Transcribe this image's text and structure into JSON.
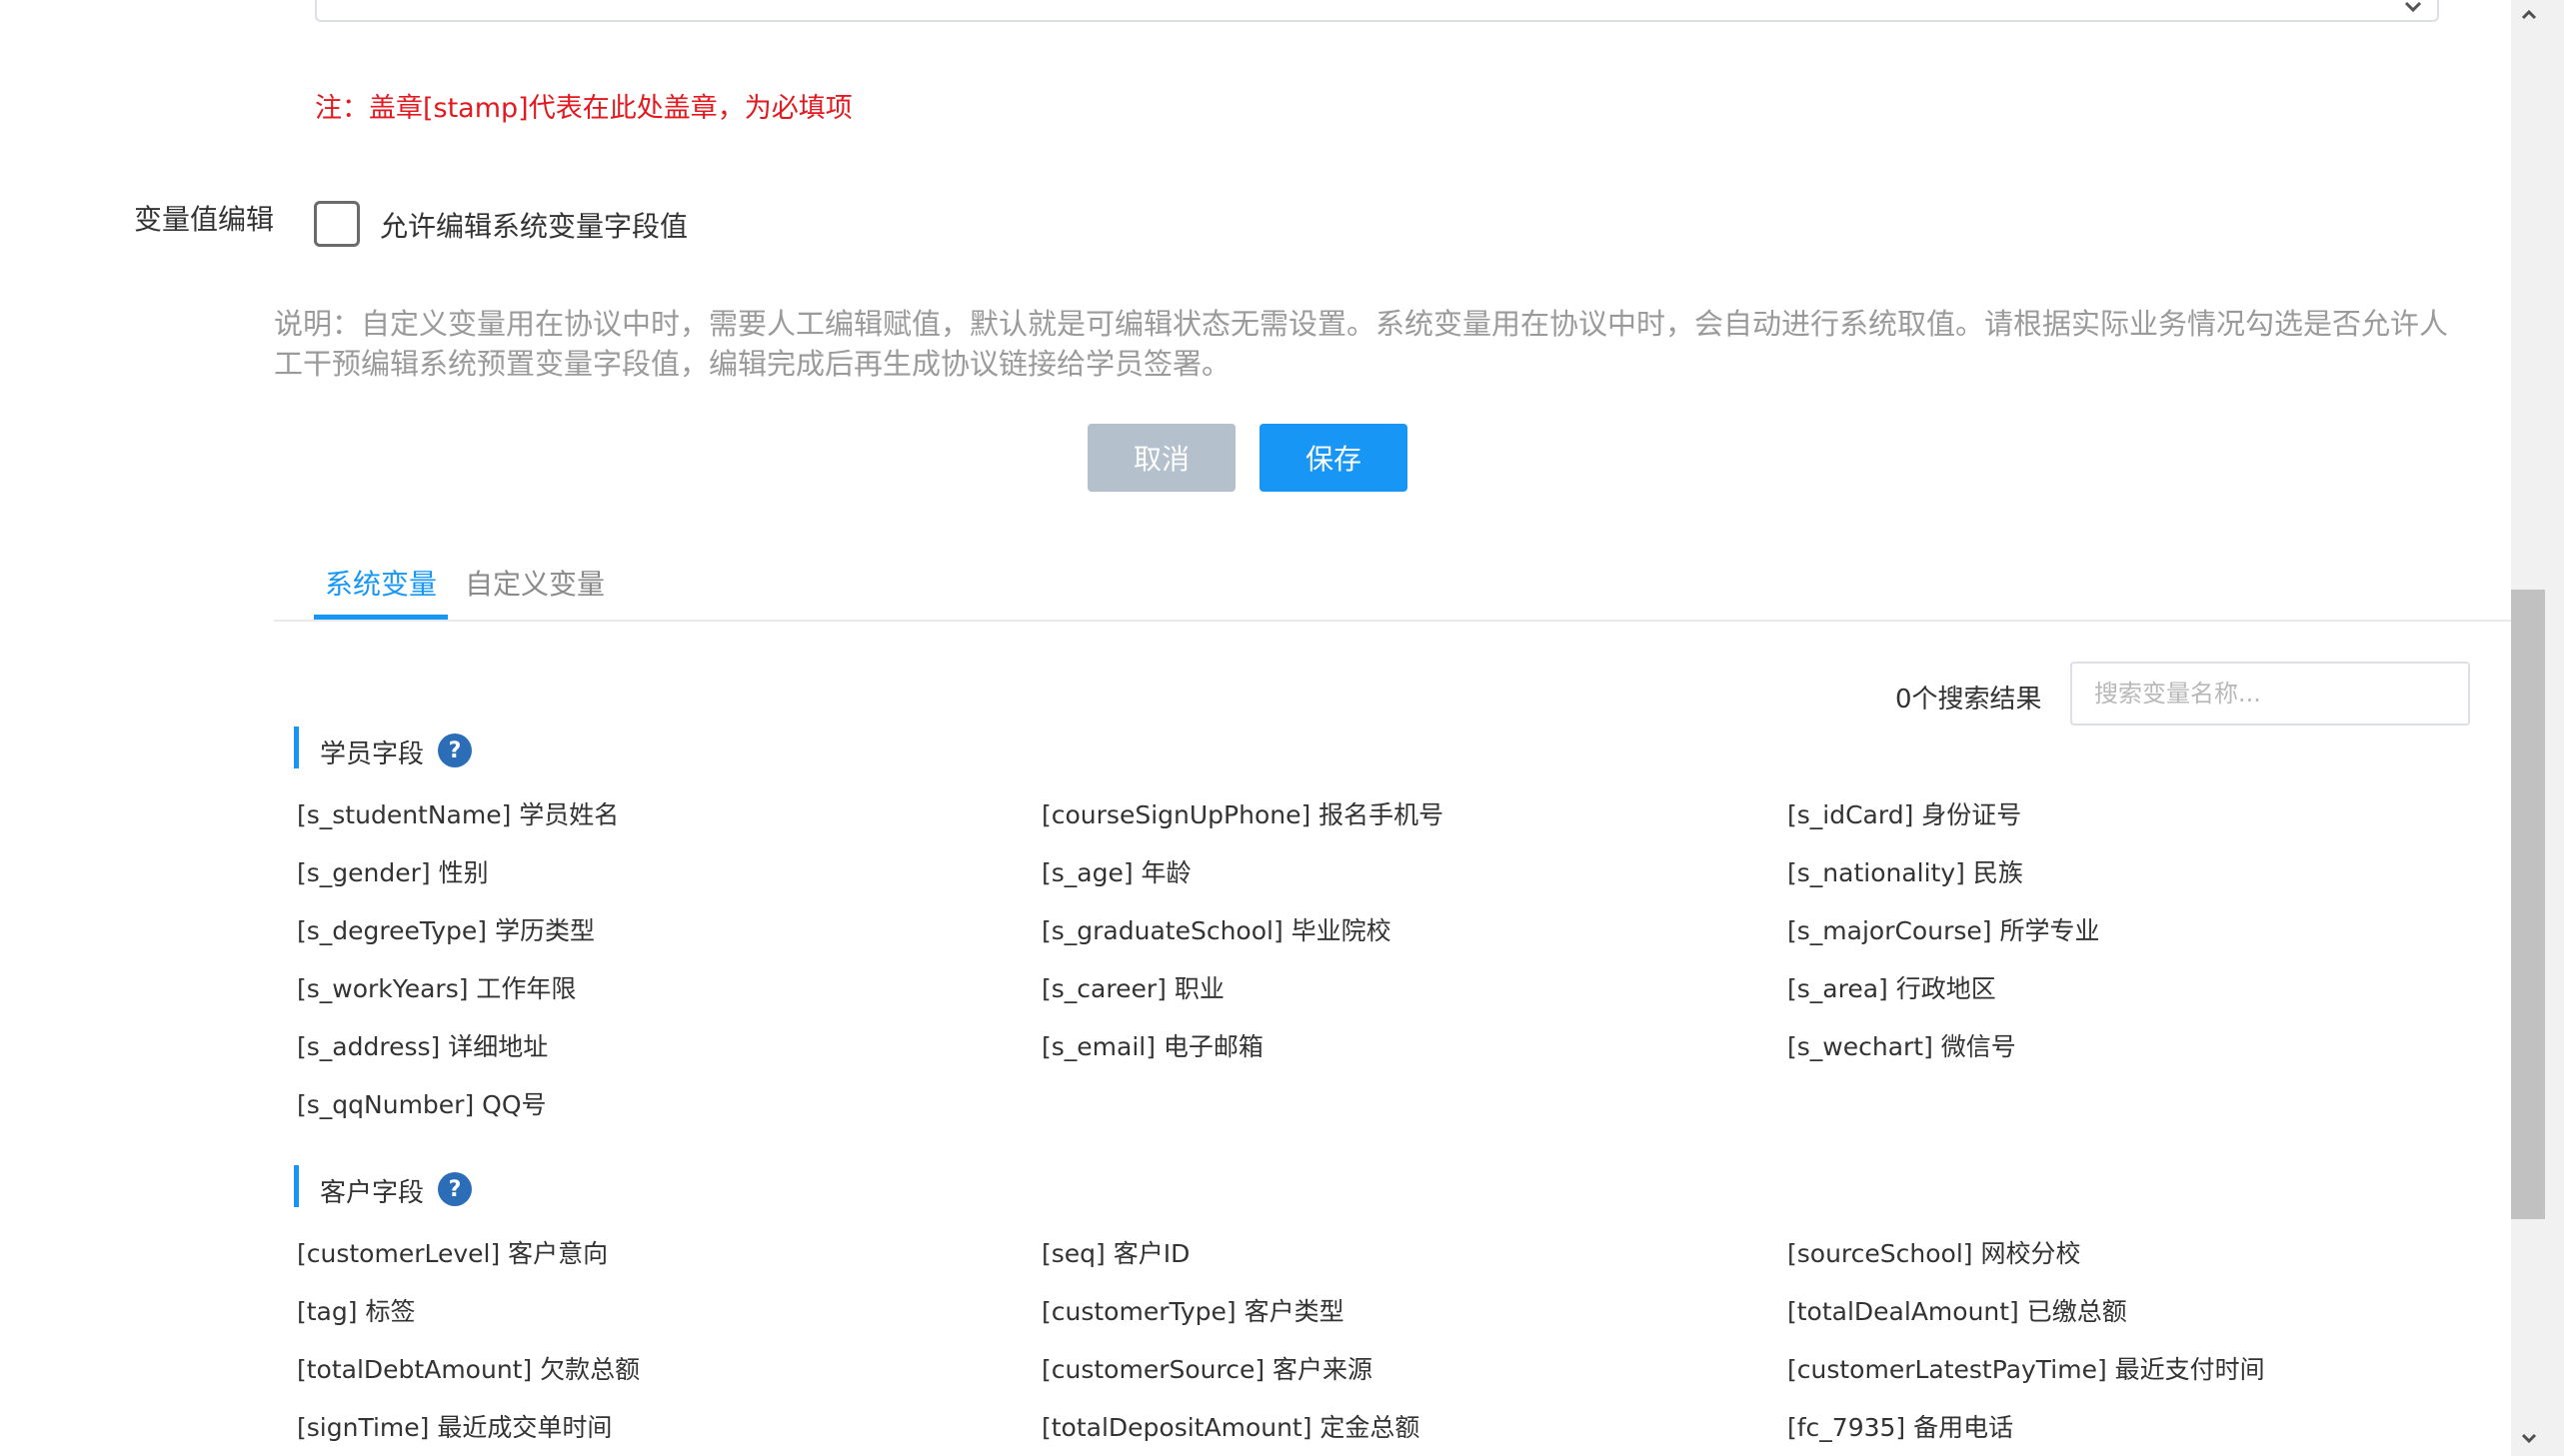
{
  "note": "注：盖章[stamp]代表在此处盖章，为必填项",
  "variable_edit": {
    "label": "变量值编辑",
    "checkbox_label": "允许编辑系统变量字段值",
    "checked": false
  },
  "description": "说明：自定义变量用在协议中时，需要人工编辑赋值，默认就是可编辑状态无需设置。系统变量用在协议中时，会自动进行系统取值。请根据实际业务情况勾选是否允许人工干预编辑系统预置变量字段值，编辑完成后再生成协议链接给学员签署。",
  "buttons": {
    "cancel": "取消",
    "save": "保存"
  },
  "tabs": [
    {
      "label": "系统变量",
      "active": true
    },
    {
      "label": "自定义变量",
      "active": false
    }
  ],
  "search": {
    "result_count": "0个搜索结果",
    "placeholder": "搜索变量名称..."
  },
  "sections": [
    {
      "title": "学员字段",
      "items": [
        "[s_studentName] 学员姓名",
        "[courseSignUpPhone] 报名手机号",
        "[s_idCard] 身份证号",
        "[s_gender] 性别",
        "[s_age] 年龄",
        "[s_nationality] 民族",
        "[s_degreeType] 学历类型",
        "[s_graduateSchool] 毕业院校",
        "[s_majorCourse] 所学专业",
        "[s_workYears] 工作年限",
        "[s_career] 职业",
        "[s_area] 行政地区",
        "[s_address] 详细地址",
        "[s_email] 电子邮箱",
        "[s_wechart] 微信号",
        "[s_qqNumber] QQ号"
      ]
    },
    {
      "title": "客户字段",
      "items": [
        "[customerLevel] 客户意向",
        "[seq] 客户ID",
        "[sourceSchool] 网校分校",
        "[tag] 标签",
        "[customerType] 客户类型",
        "[totalDealAmount] 已缴总额",
        "[totalDebtAmount] 欠款总额",
        "[customerSource] 客户来源",
        "[customerLatestPayTime] 最近支付时间",
        "[signTime] 最近成交单时间",
        "[totalDepositAmount] 定金总额",
        "[fc_7935] 备用电话"
      ]
    }
  ],
  "colors": {
    "primary": "#1896f5",
    "note": "#e4181e",
    "cancel": "#b4c1cd",
    "help_icon": "#2c6db8"
  }
}
